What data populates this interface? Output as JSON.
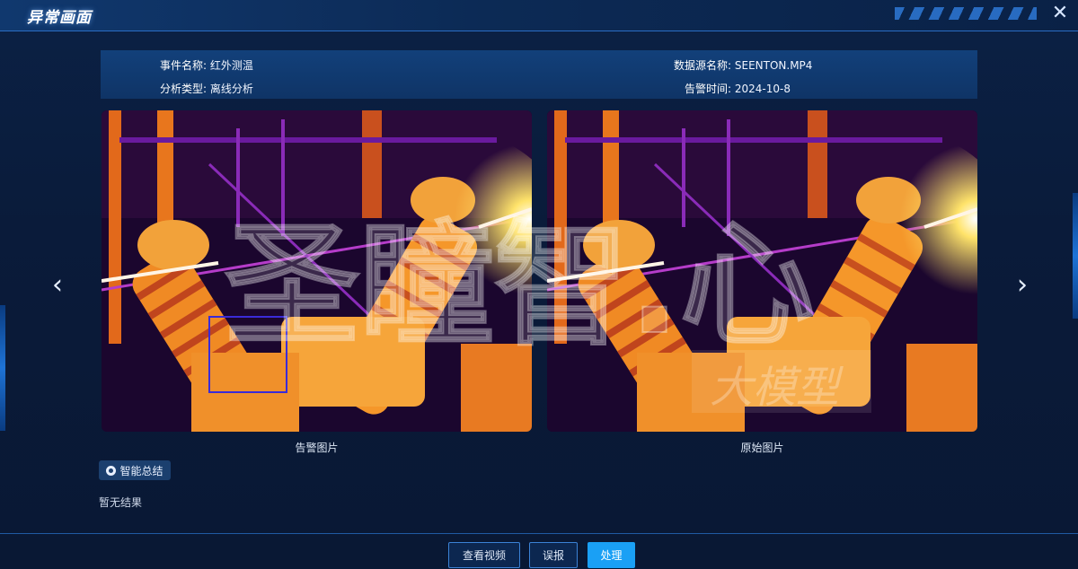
{
  "window": {
    "title": "异常画面"
  },
  "info": {
    "event_name_label": "事件名称:",
    "event_name_value": "红外测温",
    "analysis_type_label": "分析类型:",
    "analysis_type_value": "离线分析",
    "data_source_label": "数据源名称:",
    "data_source_value": "SEENTON.MP4",
    "alarm_time_label": "告警时间:",
    "alarm_time_value": "2024-10-8"
  },
  "images": {
    "alarm_caption": "告警图片",
    "original_caption": "原始图片"
  },
  "watermark": {
    "main_text": "圣瞳智.心",
    "sub_text": "大模型"
  },
  "summary": {
    "button_label": "智能总结",
    "result_text": "暂无结果"
  },
  "footer": {
    "view_video_label": "查看视频",
    "misreport_label": "误报",
    "handle_label": "处理"
  },
  "icons": {
    "close": "close-icon",
    "prev": "chevron-left-icon",
    "next": "chevron-right-icon",
    "summary": "chat-bubble-icon"
  },
  "colors": {
    "primary_button": "#1aa0f5",
    "header_line": "#2a6dc4",
    "detection_box": "#3a2bd8"
  }
}
